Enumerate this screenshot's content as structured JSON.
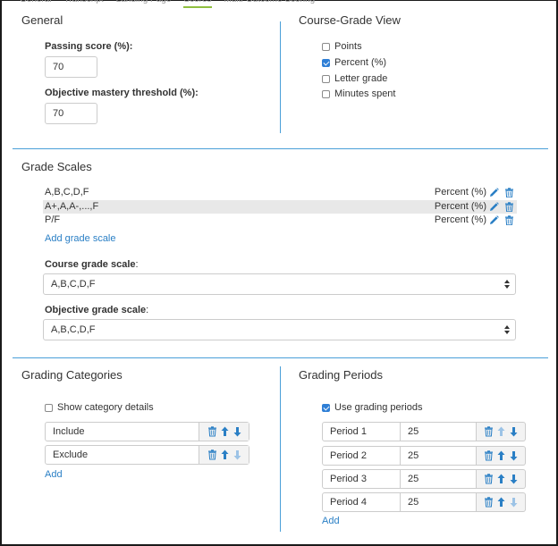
{
  "tabs": [
    "General",
    "Transcript",
    "Landing Page",
    "Scores",
    "Multi-Outcome Scoring"
  ],
  "general": {
    "title": "General",
    "passing_label": "Passing score (%):",
    "passing_value": "70",
    "mastery_label": "Objective mastery threshold (%):",
    "mastery_value": "70"
  },
  "course_grade_view": {
    "title": "Course-Grade View",
    "options": [
      {
        "label": "Points",
        "checked": false
      },
      {
        "label": "Percent (%)",
        "checked": true
      },
      {
        "label": "Letter grade",
        "checked": false
      },
      {
        "label": "Minutes spent",
        "checked": false
      }
    ]
  },
  "grade_scales": {
    "title": "Grade Scales",
    "rows": [
      {
        "name": "A,B,C,D,F",
        "type": "Percent (%)"
      },
      {
        "name": "A+,A,A-,...,F",
        "type": "Percent (%)"
      },
      {
        "name": "P/F",
        "type": "Percent (%)"
      }
    ],
    "add_link": "Add grade scale",
    "course_scale_label": "Course grade scale",
    "course_scale_value": "A,B,C,D,F",
    "objective_scale_label": "Objective grade scale",
    "objective_scale_value": "A,B,C,D,F",
    "colon": ":"
  },
  "grading_categories": {
    "title": "Grading Categories",
    "show_details_label": "Show category details",
    "show_details_checked": false,
    "items": [
      "Include",
      "Exclude"
    ],
    "add_link": "Add"
  },
  "grading_periods": {
    "title": "Grading Periods",
    "use_label": "Use grading periods",
    "use_checked": true,
    "periods": [
      {
        "name": "Period 1",
        "value": "25"
      },
      {
        "name": "Period 2",
        "value": "25"
      },
      {
        "name": "Period 3",
        "value": "25"
      },
      {
        "name": "Period 4",
        "value": "25"
      }
    ],
    "add_link": "Add"
  },
  "colors": {
    "accent": "#2a7fc5",
    "divider": "#4a9fd8",
    "tab_active": "#8fbf3f"
  }
}
